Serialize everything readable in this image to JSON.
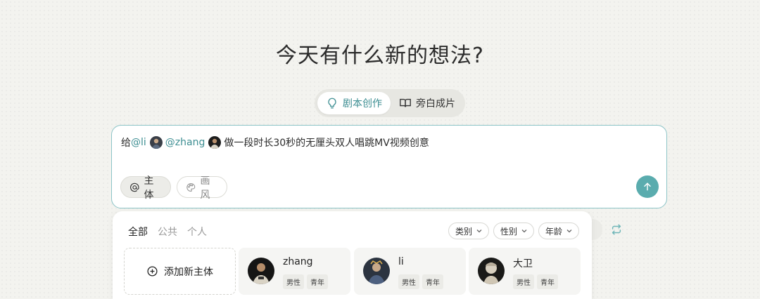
{
  "heading": "今天有什么新的想法?",
  "mode_tabs": [
    {
      "label": "剧本创作",
      "icon": "lightbulb-icon",
      "active": true
    },
    {
      "label": "旁白成片",
      "icon": "open-book-icon",
      "active": false
    }
  ],
  "composer": {
    "prompt": {
      "prefix": "给",
      "mention1": "@li",
      "mention2": "@zhang",
      "suffix": "做一段时长30秒的无厘头双人唱跳MV视频创意"
    },
    "subject_label": "主体",
    "style_label": "画风"
  },
  "panel": {
    "tabs": [
      "全部",
      "公共",
      "个人"
    ],
    "filters": [
      "类别",
      "性别",
      "年龄"
    ],
    "add_label": "添加新主体",
    "characters": [
      {
        "name": "zhang",
        "tags": [
          "男性",
          "青年"
        ]
      },
      {
        "name": "li",
        "tags": [
          "男性",
          "青年"
        ]
      },
      {
        "name": "大卫",
        "tags": [
          "男性",
          "青年"
        ]
      }
    ]
  },
  "colors": {
    "accent": "#5aacae",
    "accent_text": "#3d8e92",
    "background": "#f3f3ef"
  }
}
